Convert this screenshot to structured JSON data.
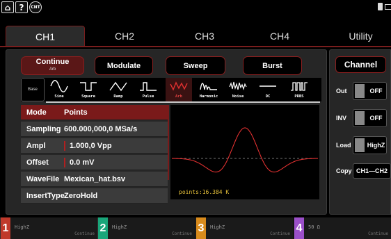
{
  "toolbar": {
    "home_label": "⌂",
    "help_label": "?",
    "cnt_label": "CNT"
  },
  "tabs": [
    {
      "label": "CH1",
      "active": true
    },
    {
      "label": "CH2"
    },
    {
      "label": "CH3"
    },
    {
      "label": "CH4"
    },
    {
      "label": "Utility"
    }
  ],
  "modes": {
    "continue_label": "Continue",
    "continue_sub": "Arb",
    "modulate_label": "Modulate",
    "sweep_label": "Sweep",
    "burst_label": "Burst"
  },
  "waveforms": {
    "base_label": "Base",
    "items": [
      {
        "label": "Sine",
        "icon": "sine-wave-icon"
      },
      {
        "label": "Square",
        "icon": "square-wave-icon"
      },
      {
        "label": "Ramp",
        "icon": "ramp-wave-icon"
      },
      {
        "label": "Pulse",
        "icon": "pulse-wave-icon"
      },
      {
        "label": "Arb",
        "icon": "arb-wave-icon",
        "selected": true
      },
      {
        "label": "Harmonic",
        "icon": "harmonic-wave-icon"
      },
      {
        "label": "Noise",
        "icon": "noise-wave-icon"
      },
      {
        "label": "DC",
        "icon": "dc-wave-icon"
      },
      {
        "label": "PRBS",
        "icon": "prbs-wave-icon"
      }
    ]
  },
  "params": [
    {
      "name": "Mode",
      "value": "Points"
    },
    {
      "name": "Sampling",
      "value": "600.000,000,0 MSa/s"
    },
    {
      "name": "Ampl",
      "value": "1.000,0 Vpp"
    },
    {
      "name": "Offset",
      "value": "0.0 mV"
    },
    {
      "name": "WaveFile",
      "value": "Mexican_hat.bsv"
    },
    {
      "name": "InsertType",
      "value": "ZeroHold"
    }
  ],
  "graph": {
    "points_label": "points:16.384 K"
  },
  "channel_panel": {
    "title": "Channel",
    "out_label": "Out",
    "out_value": "OFF",
    "inv_label": "INV",
    "inv_value": "OFF",
    "load_label": "Load",
    "load_value": "HighZ",
    "copy_label": "Copy",
    "copy_value": "CH1—CH2"
  },
  "bottom_channels": [
    {
      "num": "1",
      "impedance": "HighZ",
      "mode": "Continue",
      "color": "#c0392b"
    },
    {
      "num": "2",
      "impedance": "HighZ",
      "mode": "Continue",
      "color": "#1aa67a"
    },
    {
      "num": "3",
      "impedance": "HighZ",
      "mode": "Continue",
      "color": "#d98b1c"
    },
    {
      "num": "4",
      "impedance": "50 Ω",
      "mode": "Continue",
      "color": "#9b4fc9"
    }
  ],
  "colors": {
    "accent": "#8a1f1f",
    "trace": "#e03030",
    "points_text": "#e8c23a"
  }
}
